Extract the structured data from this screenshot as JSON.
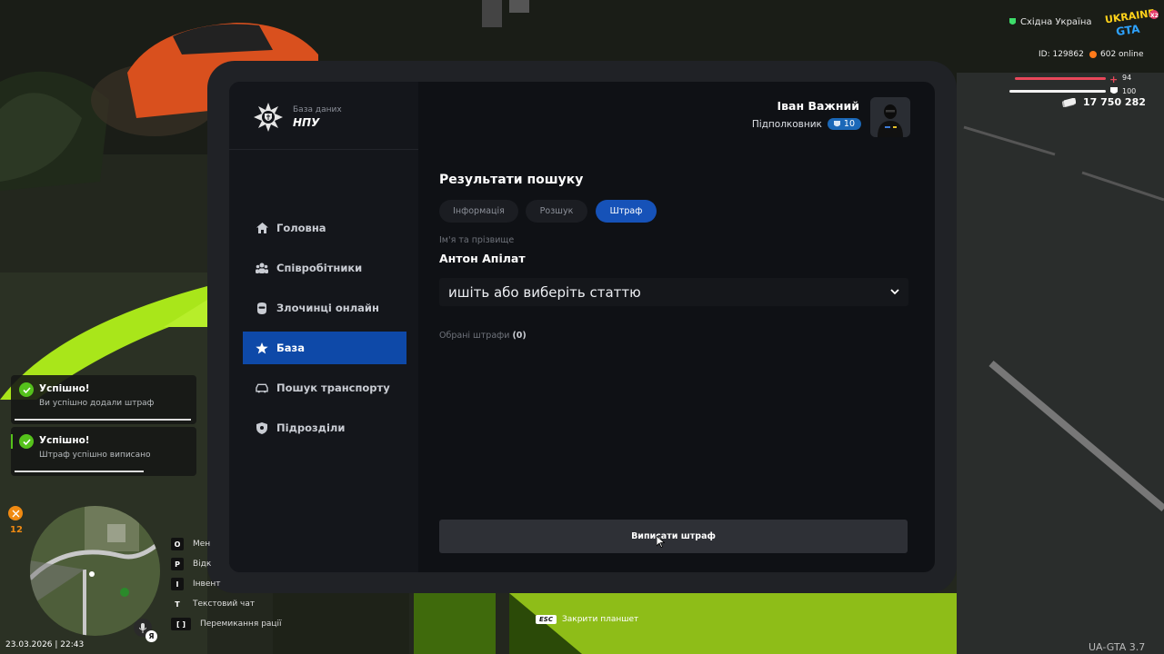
{
  "hud": {
    "server": "Східна Україна",
    "player_id": "ID: 129862",
    "online": "602 online",
    "health": "94",
    "armor": "100",
    "money": "17 750 282",
    "badge_num": "12",
    "datetime": "23.03.2026 | 22:43",
    "version": "UA-GTA 3.7",
    "esc_key": "ESC",
    "esc_label": "Закрити планшет",
    "keys": [
      {
        "key": "O",
        "label": "Мен"
      },
      {
        "key": "P",
        "label": "Відк"
      },
      {
        "key": "I",
        "label": "Інвент"
      },
      {
        "key": "T",
        "label": "Текстовий чат"
      },
      {
        "key": "[ ]",
        "label": "Перемикання рації"
      }
    ]
  },
  "notifications": [
    {
      "title": "Успішно!",
      "text": "Ви успішно додали штраф"
    },
    {
      "title": "Успішно!",
      "text": "Штраф успішно виписано"
    }
  ],
  "tablet": {
    "logo_sub": "База даних",
    "logo_main": "НПУ",
    "profile": {
      "name": "Іван Важний",
      "rank": "Підполковник",
      "level": "10"
    },
    "nav": [
      {
        "label": "Головна",
        "icon": "home-icon"
      },
      {
        "label": "Співробітники",
        "icon": "employees-icon"
      },
      {
        "label": "Злочинці онлайн",
        "icon": "criminal-icon"
      },
      {
        "label": "База",
        "icon": "star-icon",
        "active": true
      },
      {
        "label": "Пошук транспорту",
        "icon": "car-icon"
      },
      {
        "label": "Підрозділи",
        "icon": "shield-icon"
      }
    ],
    "section_title": "Результати пошуку",
    "tabs": [
      {
        "label": "Інформація"
      },
      {
        "label": "Розшук"
      },
      {
        "label": "Штраф",
        "active": true
      }
    ],
    "name_label": "Ім'я та прізвище",
    "name_value": "Антон Апілат",
    "select_placeholder": "ишіть або виберіть статтю",
    "selected_label": "Обрані штрафи",
    "selected_count": "(0)",
    "issue_button": "Виписати штраф"
  },
  "colors": {
    "accent": "#0e49a8",
    "tab_active": "#1652b8",
    "success": "#55c21b",
    "health": "#e8475a"
  }
}
